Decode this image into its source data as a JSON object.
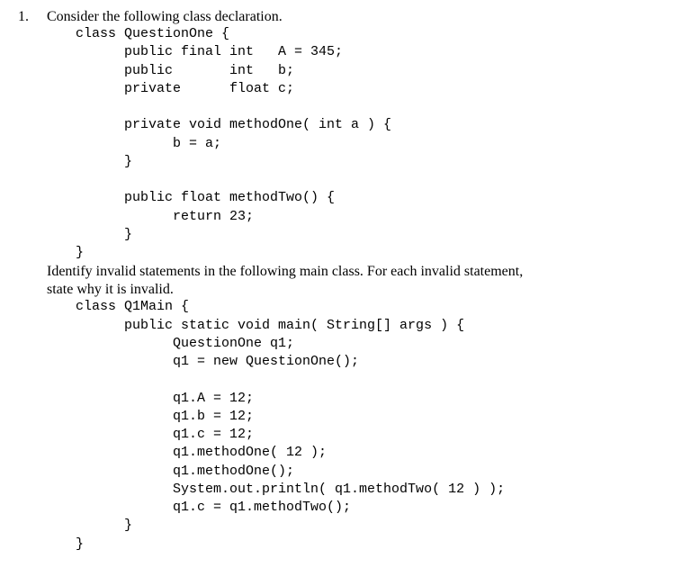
{
  "question": {
    "number": "1.",
    "prompt_line": "Consider the following class declaration.",
    "code1": "class QuestionOne {\n      public final int   A = 345;\n      public       int   b;\n      private      float c;\n\n      private void methodOne( int a ) {\n            b = a;\n      }\n\n      public float methodTwo() {\n            return 23;\n      }\n}",
    "prompt2_l1": "Identify invalid statements in the following main class.  For each invalid statement,",
    "prompt2_l2": "state why it is invalid.",
    "code2": "class Q1Main {\n      public static void main( String[] args ) {\n            QuestionOne q1;\n            q1 = new QuestionOne();\n\n            q1.A = 12;\n            q1.b = 12;\n            q1.c = 12;\n            q1.methodOne( 12 );\n            q1.methodOne();\n            System.out.println( q1.methodTwo( 12 ) );\n            q1.c = q1.methodTwo();\n      }\n}"
  }
}
